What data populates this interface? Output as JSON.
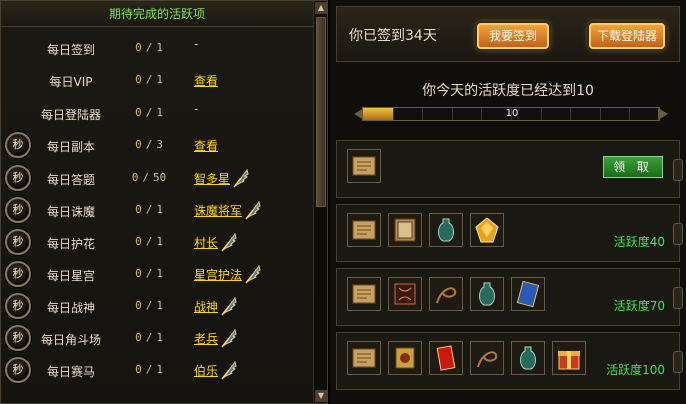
{
  "colors": {
    "accent_green": "#3ee64a",
    "title_green": "#7ee04a",
    "link_gold": "#ffd700",
    "orange": "#e8902a"
  },
  "tasks": {
    "title": "期待完成的活跃项",
    "rows": [
      {
        "label": "每日签到",
        "done": "0",
        "total": "1",
        "action": "-",
        "action_kind": "dash",
        "has_sec": false,
        "feather": false
      },
      {
        "label": "每日VIP",
        "done": "0",
        "total": "1",
        "action": "查看",
        "action_kind": "link",
        "has_sec": false,
        "feather": false
      },
      {
        "label": "每日登陆器",
        "done": "0",
        "total": "1",
        "action": "-",
        "action_kind": "dash",
        "has_sec": false,
        "feather": false
      },
      {
        "label": "每日副本",
        "done": "0",
        "total": "3",
        "action": "查看",
        "action_kind": "link",
        "has_sec": true,
        "feather": false
      },
      {
        "label": "每日答题",
        "done": "0",
        "total": "50",
        "action": "智多星",
        "action_kind": "link",
        "has_sec": true,
        "feather": true
      },
      {
        "label": "每日诛魔",
        "done": "0",
        "total": "1",
        "action": "诛魔将军",
        "action_kind": "link",
        "has_sec": true,
        "feather": true
      },
      {
        "label": "每日护花",
        "done": "0",
        "total": "1",
        "action": "村长",
        "action_kind": "link",
        "has_sec": true,
        "feather": true
      },
      {
        "label": "每日星宫",
        "done": "0",
        "total": "1",
        "action": "星宫护法",
        "action_kind": "link",
        "has_sec": true,
        "feather": true
      },
      {
        "label": "每日战神",
        "done": "0",
        "total": "1",
        "action": "战神",
        "action_kind": "link",
        "has_sec": true,
        "feather": true
      },
      {
        "label": "每日角斗场",
        "done": "0",
        "total": "1",
        "action": "老兵",
        "action_kind": "link",
        "has_sec": true,
        "feather": true
      },
      {
        "label": "每日赛马",
        "done": "0",
        "total": "1",
        "action": "伯乐",
        "action_kind": "link",
        "has_sec": true,
        "feather": true
      }
    ],
    "sec_label": "秒",
    "count_separator": "/"
  },
  "signin": {
    "text": "你已签到34天",
    "sign_button": "我要签到",
    "download_button": "下载登陆器"
  },
  "activity": {
    "text": "你今天的活跃度已经达到10",
    "progress_label": "10",
    "progress_fraction": 0.1
  },
  "rewards": [
    {
      "items": [
        "scroll-icon"
      ],
      "claim_label": "领 取",
      "value_label": ""
    },
    {
      "items": [
        "scroll-icon",
        "book-icon",
        "vase-icon",
        "gem-icon"
      ],
      "claim_label": "",
      "value_label": "活跃度40"
    },
    {
      "items": [
        "scroll-icon",
        "rune-scroll-icon",
        "whip-icon",
        "vase-icon",
        "card-icon"
      ],
      "claim_label": "",
      "value_label": "活跃度70"
    },
    {
      "items": [
        "scroll-icon",
        "talisman-icon",
        "red-envelope-icon",
        "whip-icon",
        "vase-icon",
        "gift-box-icon"
      ],
      "claim_label": "",
      "value_label": "活跃度100"
    }
  ]
}
